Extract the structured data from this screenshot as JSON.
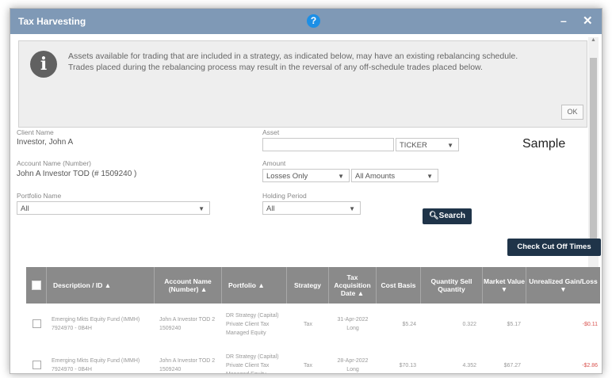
{
  "window": {
    "title": "Tax Harvesting",
    "help_icon": "?",
    "minimize_icon": "–",
    "close_icon": "✕"
  },
  "alert": {
    "icon": "i",
    "message": "Assets available for trading that are included in a strategy, as indicated below, may have an existing rebalancing schedule. Trades placed during the rebalancing process may result in the reversal of any off-schedule trades placed below.",
    "ok_label": "OK"
  },
  "form": {
    "client_name_label": "Client Name",
    "client_name_value": "Investor, John A",
    "account_label": "Account Name (Number)",
    "account_value": "John A Investor TOD (# 1509240 )",
    "portfolio_label": "Portfolio Name",
    "portfolio_value": "All",
    "asset_label": "Asset",
    "asset_value": "",
    "asset_type": "TICKER",
    "amount_label": "Amount",
    "amount_filter": "Losses Only",
    "amount_range": "All Amounts",
    "holding_label": "Holding Period",
    "holding_value": "All",
    "search_label": "Search",
    "cutoff_label": "Check Cut Off Times"
  },
  "sample_label": "Sample",
  "table": {
    "headers": [
      "Description / ID",
      "Account Name (Number)",
      "Portfolio",
      "Strategy",
      "Tax Acquisition Date",
      "Cost Basis",
      "Quantity Sell Quantity",
      "Market Value",
      "Unrealized Gain/Loss"
    ],
    "rows": [
      {
        "description": "Emerging Mkts Equity Fund (IMMH) 7924970 - 0B4H",
        "account": "John A Investor TOD 2 1509240",
        "portfolio": "DR Strategy (Capital) Private Client Tax Managed Equity",
        "strategy": "Tax",
        "acq_date": "31-Apr-2022",
        "term": "Long",
        "cost_basis": "$5.24",
        "quantity": "0.322",
        "market_value": "$5.17",
        "gain_loss": "-$0.11"
      },
      {
        "description": "Emerging Mkts Equity Fund (IMMH) 7924970 - 0B4H",
        "account": "John A Investor TOD 2 1509240",
        "portfolio": "DR Strategy (Capital) Private Client Tax Managed Equity",
        "strategy": "Tax",
        "acq_date": "28-Apr-2022",
        "term": "Long",
        "cost_basis": "$70.13",
        "quantity": "4.352",
        "market_value": "$67.27",
        "gain_loss": "-$2.86"
      }
    ]
  },
  "colors": {
    "title_bar": "#7f99b6",
    "button_dark": "#1f3449",
    "table_header": "#8a8a8a",
    "negative": "#d9534f"
  }
}
